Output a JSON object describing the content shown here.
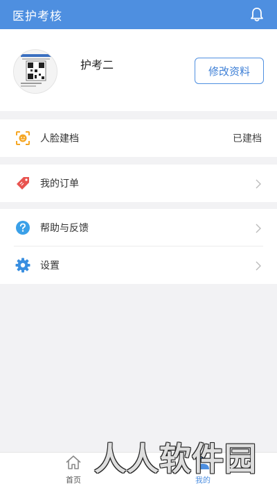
{
  "header": {
    "title": "医护考核",
    "icon": "bell-icon"
  },
  "profile": {
    "username": "护考二",
    "edit_label": "修改资料"
  },
  "menu": {
    "face": {
      "label": "人脸建档",
      "value": "已建档",
      "icon": "face-scan-icon"
    },
    "orders": {
      "label": "我的订单",
      "icon": "tag-icon"
    },
    "help": {
      "label": "帮助与反馈",
      "icon": "question-icon"
    },
    "settings": {
      "label": "设置",
      "icon": "gear-icon"
    }
  },
  "tabs": [
    {
      "label": "首页",
      "icon": "home-icon",
      "active": false
    },
    {
      "label": "我的",
      "icon": "user-icon",
      "active": true
    }
  ],
  "watermark": "人人软件园",
  "colors": {
    "primary": "#4e8fe0",
    "orange": "#f5a623",
    "red": "#e8534f",
    "blue": "#3aa0e8"
  }
}
